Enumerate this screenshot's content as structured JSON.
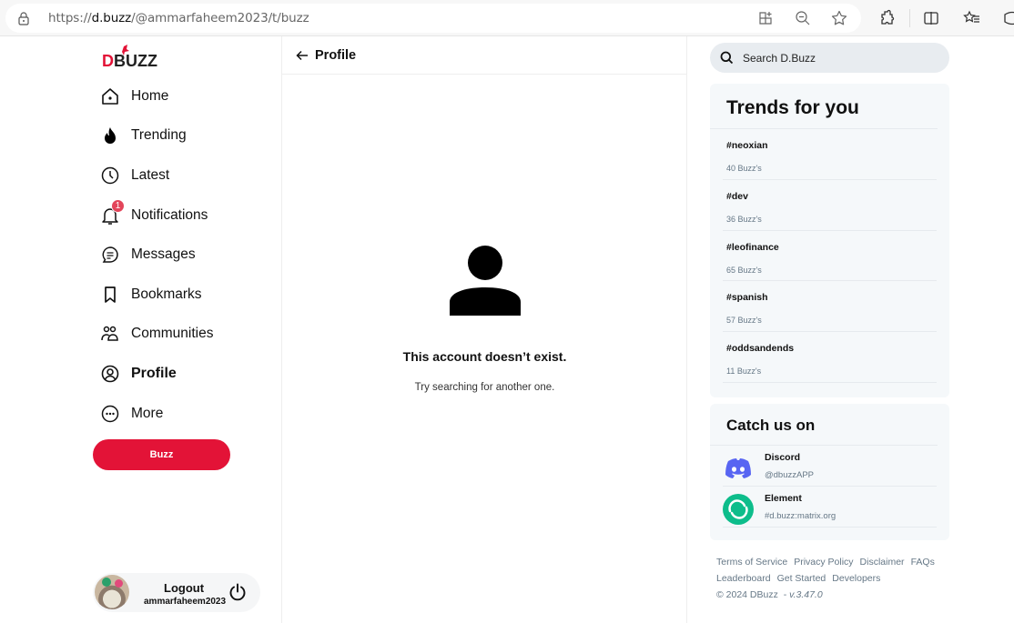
{
  "browser": {
    "url_prefix": "https://",
    "url_domain": "d.buzz",
    "url_path": "/@ammarfaheem2023/t/buzz",
    "icons": [
      "lock-icon",
      "app-grid-icon",
      "zoom-out-icon",
      "favorite-star-icon",
      "extensions-icon",
      "split-screen-icon",
      "favorites-list-icon",
      "browser-essentials-icon"
    ]
  },
  "brand": {
    "logo_d": "D",
    "logo_rest": "BUZZ",
    "accent": "#e31337"
  },
  "sidebar": {
    "items": [
      {
        "label": "Home",
        "icon": "home-icon"
      },
      {
        "label": "Trending",
        "icon": "flame-icon"
      },
      {
        "label": "Latest",
        "icon": "clock-icon"
      },
      {
        "label": "Notifications",
        "icon": "bell-icon",
        "badge": "1"
      },
      {
        "label": "Messages",
        "icon": "message-icon"
      },
      {
        "label": "Bookmarks",
        "icon": "bookmark-icon"
      },
      {
        "label": "Communities",
        "icon": "communities-icon"
      },
      {
        "label": "Profile",
        "icon": "profile-icon",
        "active": true
      },
      {
        "label": "More",
        "icon": "more-icon"
      }
    ],
    "buzz_button": "Buzz",
    "user": {
      "logout_label": "Logout",
      "username": "ammarfaheem2023"
    }
  },
  "main": {
    "header_title": "Profile",
    "empty_title": "This account doesn’t exist.",
    "empty_subtitle": "Try searching for another one."
  },
  "right": {
    "search_placeholder": "Search D.Buzz",
    "trends_title": "Trends for you",
    "trends": [
      {
        "tag": "#neoxian",
        "count": "40 Buzz's"
      },
      {
        "tag": "#dev",
        "count": "36 Buzz's"
      },
      {
        "tag": "#leofinance",
        "count": "65 Buzz's"
      },
      {
        "tag": "#spanish",
        "count": "57 Buzz's"
      },
      {
        "tag": "#oddsandends",
        "count": "11 Buzz's"
      }
    ],
    "catch_title": "Catch us on",
    "socials": [
      {
        "name": "Discord",
        "handle": "@dbuzzAPP",
        "color": "#5865f2"
      },
      {
        "name": "Element",
        "handle": "#d.buzz:matrix.org",
        "color": "#0dbd8b"
      }
    ],
    "footer_links": [
      "Terms of Service",
      "Privacy Policy",
      "Disclaimer",
      "FAQs",
      "Leaderboard",
      "Get Started",
      "Developers"
    ],
    "copyright": "© 2024 DBuzz",
    "version": "v.3.47.0"
  }
}
